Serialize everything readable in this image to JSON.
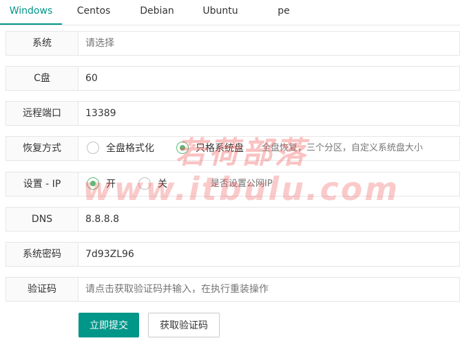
{
  "tabs": [
    {
      "label": "Windows",
      "active": true
    },
    {
      "label": "Centos"
    },
    {
      "label": "Debian"
    },
    {
      "label": "Ubuntu"
    },
    {
      "label": "pe"
    }
  ],
  "form": {
    "system": {
      "label": "系统",
      "placeholder": "请选择"
    },
    "c_drive": {
      "label": "C盘",
      "value": "60"
    },
    "remote_port": {
      "label": "远程端口",
      "value": "13389"
    },
    "restore_mode": {
      "label": "恢复方式",
      "options": [
        {
          "label": "全盘格式化",
          "checked": false
        },
        {
          "label": "只格系统盘",
          "checked": true
        }
      ],
      "hint": "全盘恢复，三个分区，自定义系统盘大小"
    },
    "ip_setting": {
      "label": "设置 - IP",
      "options": [
        {
          "label": "开",
          "checked": true
        },
        {
          "label": "关",
          "checked": false
        }
      ],
      "hint": "是否设置公网IP"
    },
    "dns": {
      "label": "DNS",
      "value": "8.8.8.8"
    },
    "password": {
      "label": "系统密码",
      "value": "7d93ZL96"
    },
    "captcha": {
      "label": "验证码",
      "placeholder": "请点击获取验证码并输入，在执行重装操作"
    }
  },
  "buttons": {
    "submit": "立即提交",
    "get_code": "获取验证码"
  },
  "watermark": {
    "line1": "若荷部落",
    "line2": "www.itbulu.com"
  },
  "colors": {
    "accent": "#009688",
    "radio": "#5fb878",
    "watermark": "#f05050"
  }
}
